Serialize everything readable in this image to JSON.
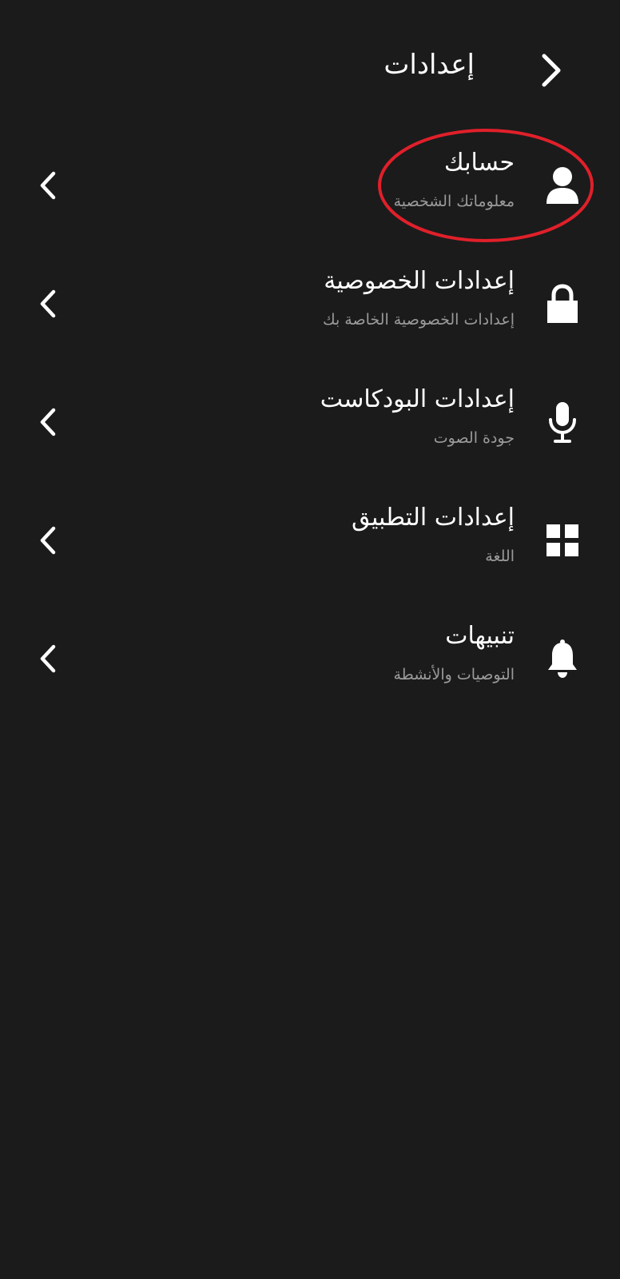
{
  "header": {
    "title": "إعدادات",
    "back_icon": "chevron-right-icon"
  },
  "settings": {
    "items": [
      {
        "key": "account",
        "title": "حسابك",
        "subtitle": "معلوماتك الشخصية",
        "icon": "person-icon"
      },
      {
        "key": "privacy",
        "title": "إعدادات الخصوصية",
        "subtitle": "إعدادات الخصوصية الخاصة بك",
        "icon": "lock-icon"
      },
      {
        "key": "podcast",
        "title": "إعدادات البودكاست",
        "subtitle": "جودة الصوت",
        "icon": "microphone-icon"
      },
      {
        "key": "app",
        "title": "إعدادات التطبيق",
        "subtitle": "اللغة",
        "icon": "grid-icon"
      },
      {
        "key": "notifications",
        "title": "تنبيهات",
        "subtitle": "التوصيات والأنشطة",
        "icon": "bell-icon"
      }
    ]
  },
  "colors": {
    "background": "#1b1b1b",
    "text_primary": "#ffffff",
    "text_secondary": "#9a9a9a",
    "highlight": "#e0202a"
  }
}
